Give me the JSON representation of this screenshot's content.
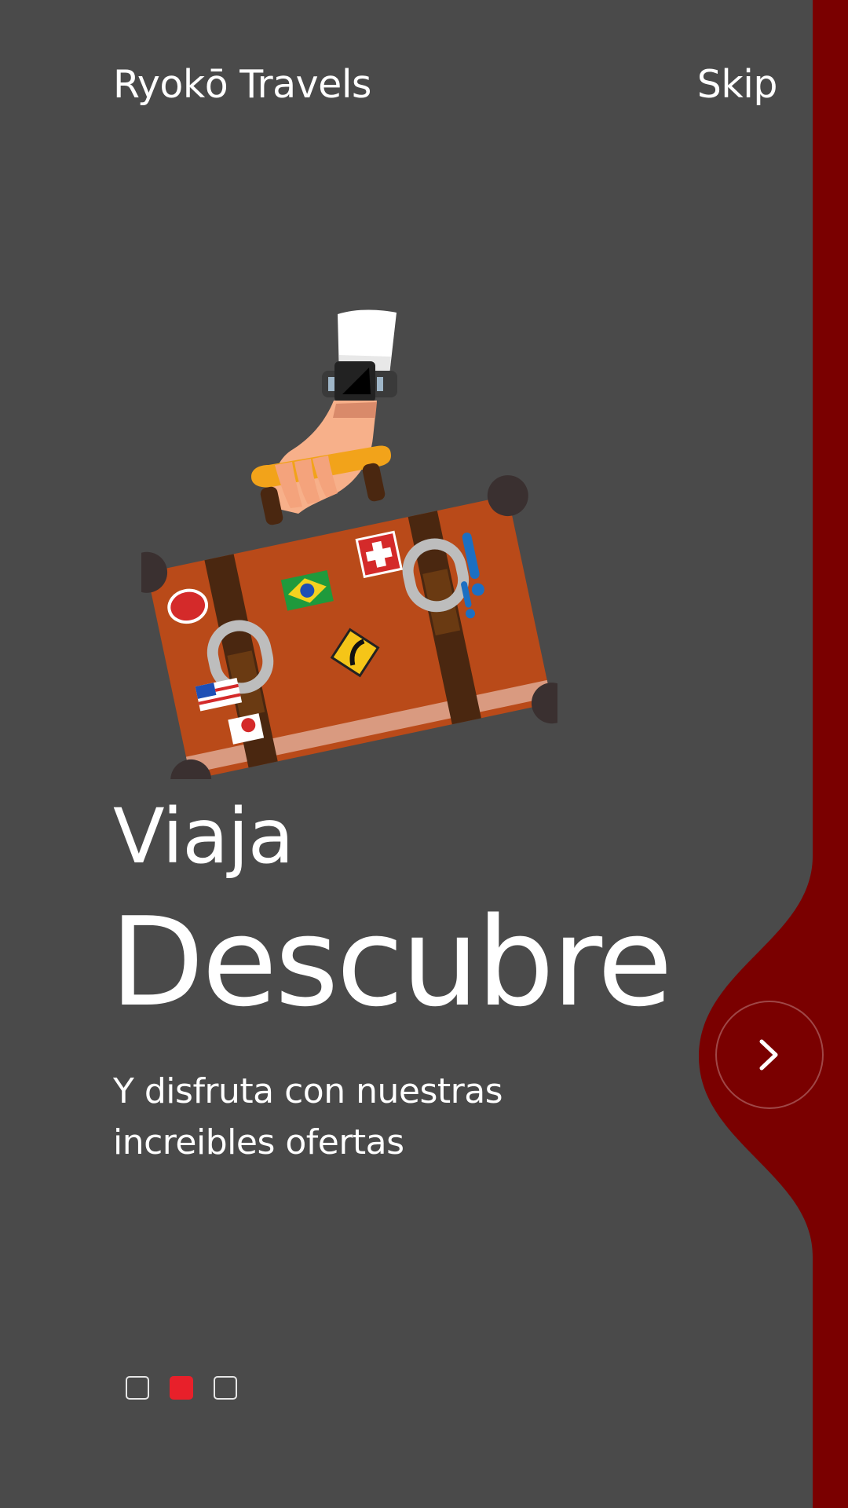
{
  "app": {
    "brand": "Ryokō Travels",
    "skip_label": "Skip"
  },
  "slide": {
    "headline_small": "Viaja",
    "headline_big": "Descubre",
    "subtitle": "Y disfruta con nuestras increibles ofertas"
  },
  "pagination": {
    "count": 3,
    "active_index": 1
  },
  "colors": {
    "background": "#4a4a4a",
    "accent_panel": "#7a0000",
    "active_dot": "#e8202a",
    "text": "#ffffff"
  },
  "icons": {
    "next": "chevron-right-icon"
  }
}
